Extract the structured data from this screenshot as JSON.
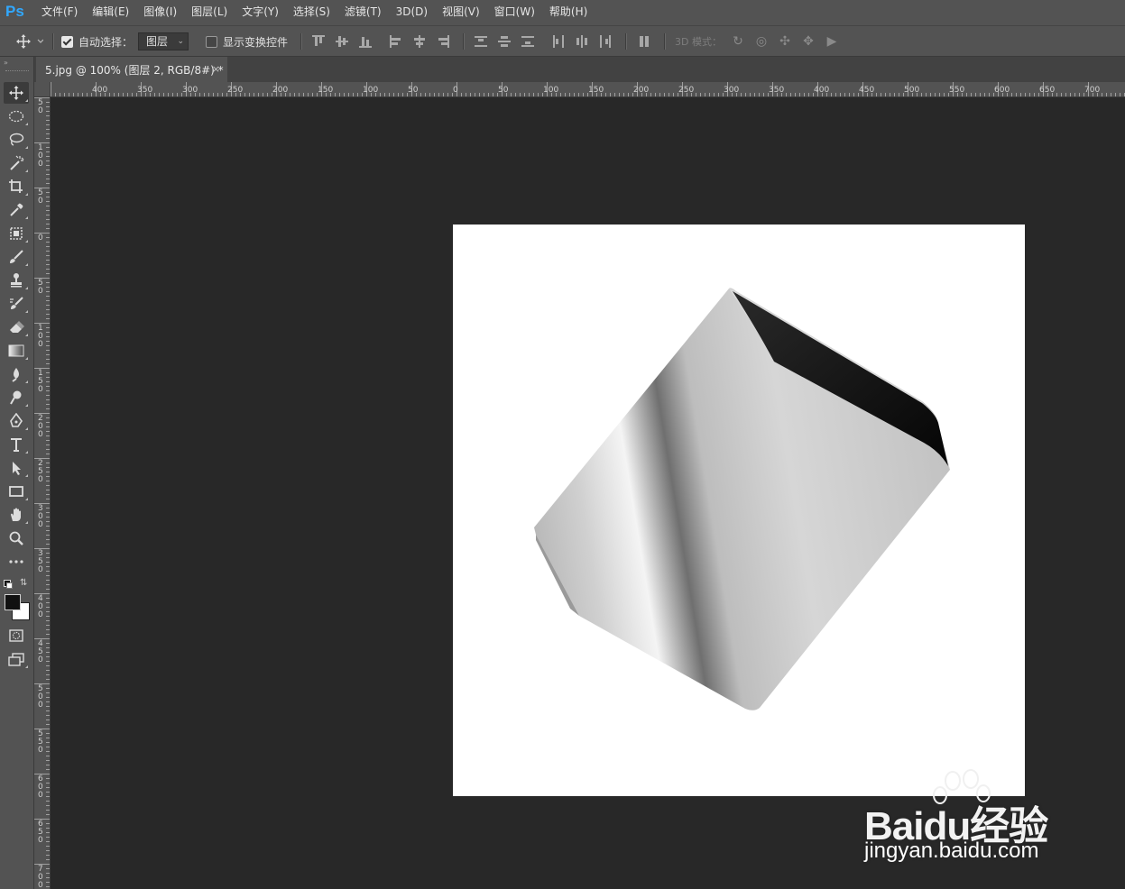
{
  "app": {
    "logo": "Ps"
  },
  "menus": [
    "文件(F)",
    "编辑(E)",
    "图像(I)",
    "图层(L)",
    "文字(Y)",
    "选择(S)",
    "滤镜(T)",
    "3D(D)",
    "视图(V)",
    "窗口(W)",
    "帮助(H)"
  ],
  "options": {
    "auto_select_label": "自动选择：",
    "auto_select_checked": true,
    "auto_select_target": "图层",
    "show_transform_label": "显示变换控件",
    "show_transform_checked": false,
    "mode_3d_label": "3D 模式："
  },
  "document": {
    "tab_title": "5.jpg @ 100% (图层 2, RGB/8#) *",
    "close_glyph": "×"
  },
  "ruler": {
    "h_labels": [
      "400",
      "350",
      "300",
      "250",
      "200",
      "150",
      "100",
      "50",
      "0",
      "50",
      "100",
      "150",
      "200",
      "250",
      "300",
      "350",
      "400",
      "450",
      "500",
      "550",
      "600",
      "650",
      "700"
    ],
    "v_labels": [
      "5 0",
      "1 0 0",
      "5 0",
      "0",
      "5 0",
      "1 0 0",
      "1 5 0",
      "2 0 0",
      "2 5 0",
      "3 0 0",
      "3 5 0",
      "4 0 0",
      "4 5 0",
      "5 0 0",
      "5 5 0",
      "6 0 0",
      "6 5 0",
      "7 0 0"
    ]
  },
  "watermark": {
    "logo": "Baidu经验",
    "url": "jingyan.baidu.com"
  },
  "colors": {
    "menubar": "#535353",
    "workspace": "#282828",
    "canvas": "#ffffff",
    "accent": "#31a8ff"
  }
}
